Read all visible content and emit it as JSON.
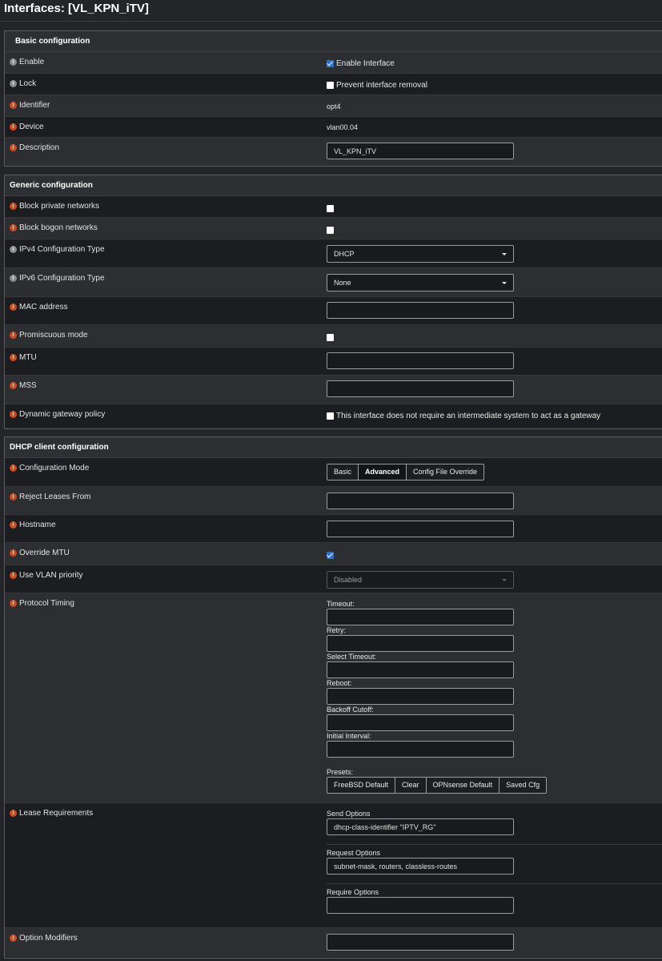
{
  "page": {
    "title": "Interfaces: [VL_KPN_iTV]"
  },
  "basic": {
    "title": "Basic configuration",
    "enable": {
      "label": "Enable",
      "checkbox_label": "Enable Interface"
    },
    "lock": {
      "label": "Lock",
      "checkbox_label": "Prevent interface removal"
    },
    "identifier": {
      "label": "Identifier",
      "value": "opt4"
    },
    "device": {
      "label": "Device",
      "value": "vlan00.04"
    },
    "description": {
      "label": "Description",
      "value": "VL_KPN_iTV"
    }
  },
  "generic": {
    "title": "Generic configuration",
    "block_private": {
      "label": "Block private networks"
    },
    "block_bogon": {
      "label": "Block bogon networks"
    },
    "ipv4": {
      "label": "IPv4 Configuration Type",
      "value": "DHCP"
    },
    "ipv6": {
      "label": "IPv6 Configuration Type",
      "value": "None"
    },
    "mac": {
      "label": "MAC address",
      "value": ""
    },
    "promisc": {
      "label": "Promiscuous mode"
    },
    "mtu": {
      "label": "MTU",
      "value": ""
    },
    "mss": {
      "label": "MSS",
      "value": ""
    },
    "gateway_policy": {
      "label": "Dynamic gateway policy",
      "checkbox_label": "This interface does not require an intermediate system to act as a gateway"
    }
  },
  "dhcp": {
    "title": "DHCP client configuration",
    "config_mode": {
      "label": "Configuration Mode",
      "options": [
        "Basic",
        "Advanced",
        "Config File Override"
      ],
      "selected": "Advanced"
    },
    "reject_leases": {
      "label": "Reject Leases From",
      "value": ""
    },
    "hostname": {
      "label": "Hostname",
      "value": ""
    },
    "override_mtu": {
      "label": "Override MTU"
    },
    "vlan_priority": {
      "label": "Use VLAN priority",
      "value": "Disabled"
    },
    "timing": {
      "label": "Protocol Timing",
      "fields": [
        "Timeout:",
        "Retry:",
        "Select Timeout:",
        "Reboot:",
        "Backoff Cutoff:",
        "Initial Interval:"
      ],
      "presets_label": "Presets:",
      "presets": [
        "FreeBSD Default",
        "Clear",
        "OPNsense Default",
        "Saved Cfg"
      ]
    },
    "lease_req": {
      "label": "Lease Requirements",
      "send_label": "Send Options",
      "send_value": "dhcp-class-identifier \"IPTV_RG\"",
      "request_label": "Request Options",
      "request_value": "subnet-mask, routers, classless-routes",
      "require_label": "Require Options",
      "require_value": ""
    },
    "option_modifiers": {
      "label": "Option Modifiers",
      "value": ""
    }
  },
  "colors": {
    "info_icon": "#d2491e",
    "info_icon_muted": "#8b8d91",
    "checkbox_checked": "#2d6fdc"
  },
  "icons": {
    "info": "info-circle-icon",
    "checkbox": "checkbox-icon",
    "dropdown": "chevron-down-icon"
  }
}
